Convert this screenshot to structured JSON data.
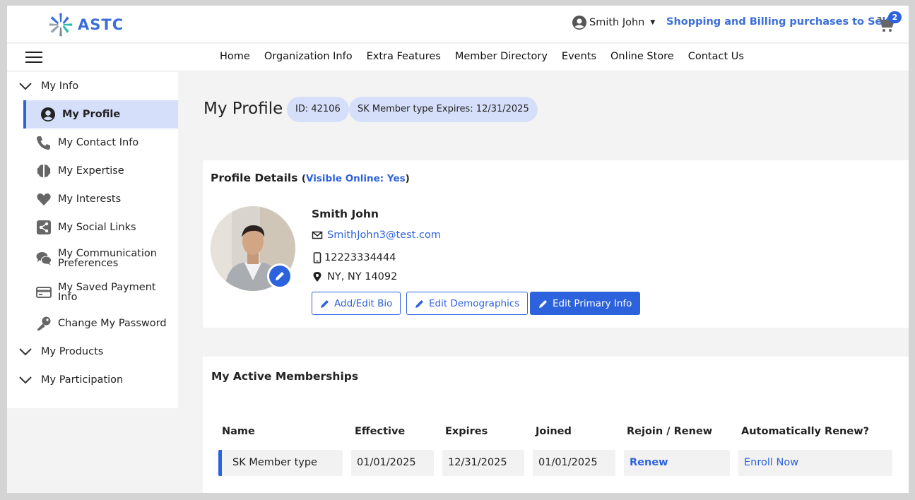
{
  "brand": {
    "name": "ASTC"
  },
  "header": {
    "user_name": "Smith John",
    "shopping_text": "Shopping and Billing purchases to Self",
    "cart_count": "2"
  },
  "nav": {
    "items": [
      "Home",
      "Organization Info",
      "Extra Features",
      "Member Directory",
      "Events",
      "Online Store",
      "Contact Us"
    ]
  },
  "sidebar": {
    "group_my_info": "My Info",
    "items": [
      {
        "label": "My Profile",
        "icon": "user-circle-icon"
      },
      {
        "label": "My Contact Info",
        "icon": "phone-icon"
      },
      {
        "label": "My Expertise",
        "icon": "brain-icon"
      },
      {
        "label": "My Interests",
        "icon": "heart-icon"
      },
      {
        "label": "My Social Links",
        "icon": "share-icon"
      },
      {
        "label": "My Communication Preferences",
        "icon": "comments-icon"
      },
      {
        "label": "My Saved Payment Info",
        "icon": "credit-card-icon"
      },
      {
        "label": "Change My Password",
        "icon": "key-icon"
      }
    ],
    "comm_line1": "My Communication",
    "comm_line2": "Preferences",
    "pay_line1": "My Saved Payment",
    "pay_line2": "Info",
    "group_my_products": "My Products",
    "group_my_participation": "My Participation"
  },
  "page": {
    "title": "My Profile",
    "id_badge": "ID: 42106",
    "expiry_badge": "SK Member type Expires: 12/31/2025"
  },
  "profile": {
    "section_title": "Profile Details",
    "visible_prefix": "(",
    "visible_label": "Visible Online: Yes",
    "visible_suffix": ")",
    "name": "Smith John",
    "email": "SmithJohn3@test.com",
    "phone": "12223334444",
    "location": "NY, NY 14092",
    "btn_bio": "Add/Edit Bio",
    "btn_demographics": "Edit Demographics",
    "btn_primary": "Edit Primary Info"
  },
  "memberships": {
    "section_title": "My Active Memberships",
    "columns": [
      "Name",
      "Effective",
      "Expires",
      "Joined",
      "Rejoin / Renew",
      "Automatically Renew?"
    ],
    "rows": [
      {
        "name": "SK Member type",
        "effective": "01/01/2025",
        "expires": "12/31/2025",
        "joined": "01/01/2025",
        "renew": "Renew",
        "auto_renew": "Enroll Now"
      }
    ]
  },
  "colors": {
    "accent": "#2d62dd",
    "active_bg": "#d6dffa"
  }
}
